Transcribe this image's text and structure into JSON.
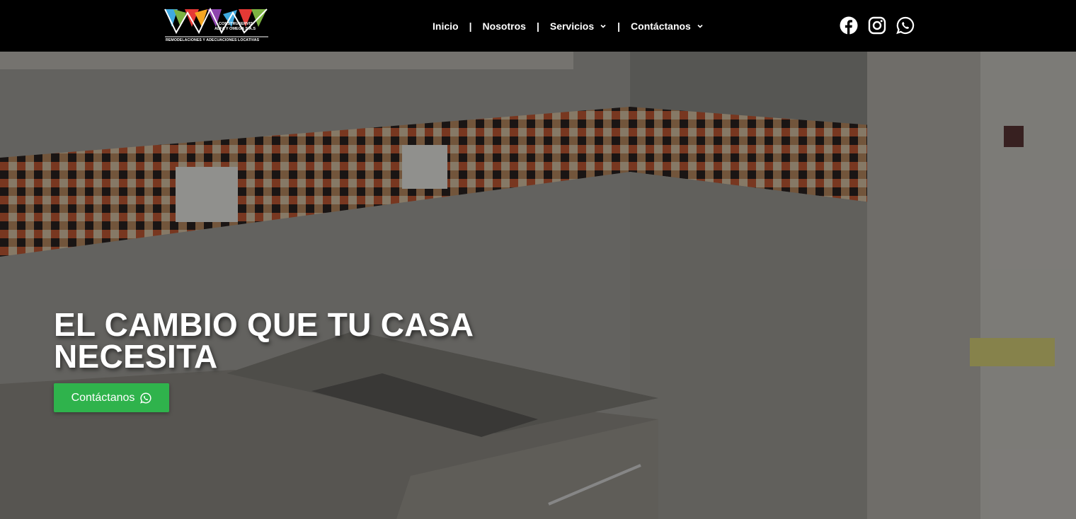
{
  "brand": {
    "line1": "CONSTRUSERVIS",
    "line2": "ALFA Y OMEGA S.A.S",
    "line3": "REMODELACIONES Y ADECUACIONES LOCATIVAS",
    "colors": [
      "#3fa9e0",
      "#e53935",
      "#f5a623",
      "#7cb342",
      "#8e44ad",
      "#ffffff"
    ]
  },
  "nav": {
    "items": [
      {
        "label": "Inicio",
        "has_dropdown": false
      },
      {
        "label": "Nosotros",
        "has_dropdown": false
      },
      {
        "label": "Servicios",
        "has_dropdown": true
      },
      {
        "label": "Contáctanos",
        "has_dropdown": true
      }
    ],
    "separator": "|"
  },
  "social": {
    "icons": [
      "facebook-icon",
      "instagram-icon",
      "whatsapp-icon"
    ]
  },
  "hero": {
    "headline": "EL CAMBIO QUE TU CASA NECESITA",
    "cta_label": "Contáctanos",
    "cta_icon": "whatsapp-icon",
    "cta_color": "#2fb34c"
  }
}
